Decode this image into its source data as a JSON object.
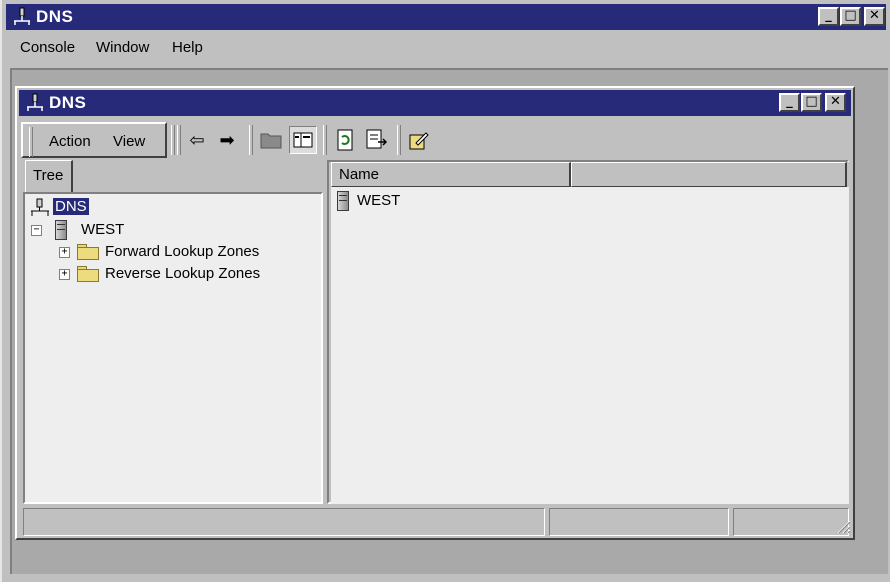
{
  "outer_window": {
    "title": "DNS",
    "menu": [
      {
        "label": "Console"
      },
      {
        "label": "Window"
      },
      {
        "label": "Help"
      }
    ],
    "buttons": {
      "minimize": "_",
      "maximize": "□",
      "close": "✕"
    }
  },
  "inner_window": {
    "title": "DNS",
    "buttons": {
      "minimize": "_",
      "maximize": "□",
      "close": "✕"
    }
  },
  "toolbar": {
    "action_label": "Action",
    "view_label": "View",
    "icons": [
      "back-arrow-icon",
      "forward-arrow-icon",
      "folder-icon",
      "show-hide-tree-icon",
      "refresh-icon",
      "export-list-icon",
      "properties-icon"
    ]
  },
  "tree": {
    "tab_label": "Tree",
    "root": {
      "label": "DNS",
      "icon": "dns-network-icon"
    },
    "server": {
      "label": "WEST",
      "icon": "server-icon"
    },
    "children": [
      {
        "label": "Forward Lookup Zones",
        "icon": "folder-icon"
      },
      {
        "label": "Reverse Lookup Zones",
        "icon": "folder-icon"
      }
    ]
  },
  "list": {
    "column_name": "Name",
    "items": [
      {
        "label": "WEST",
        "icon": "server-icon"
      }
    ]
  },
  "colors": {
    "titlebar": "#262a78",
    "face": "#c0c0c0",
    "pane": "#eeeeee",
    "mdi_background": "#a9a9a9"
  }
}
